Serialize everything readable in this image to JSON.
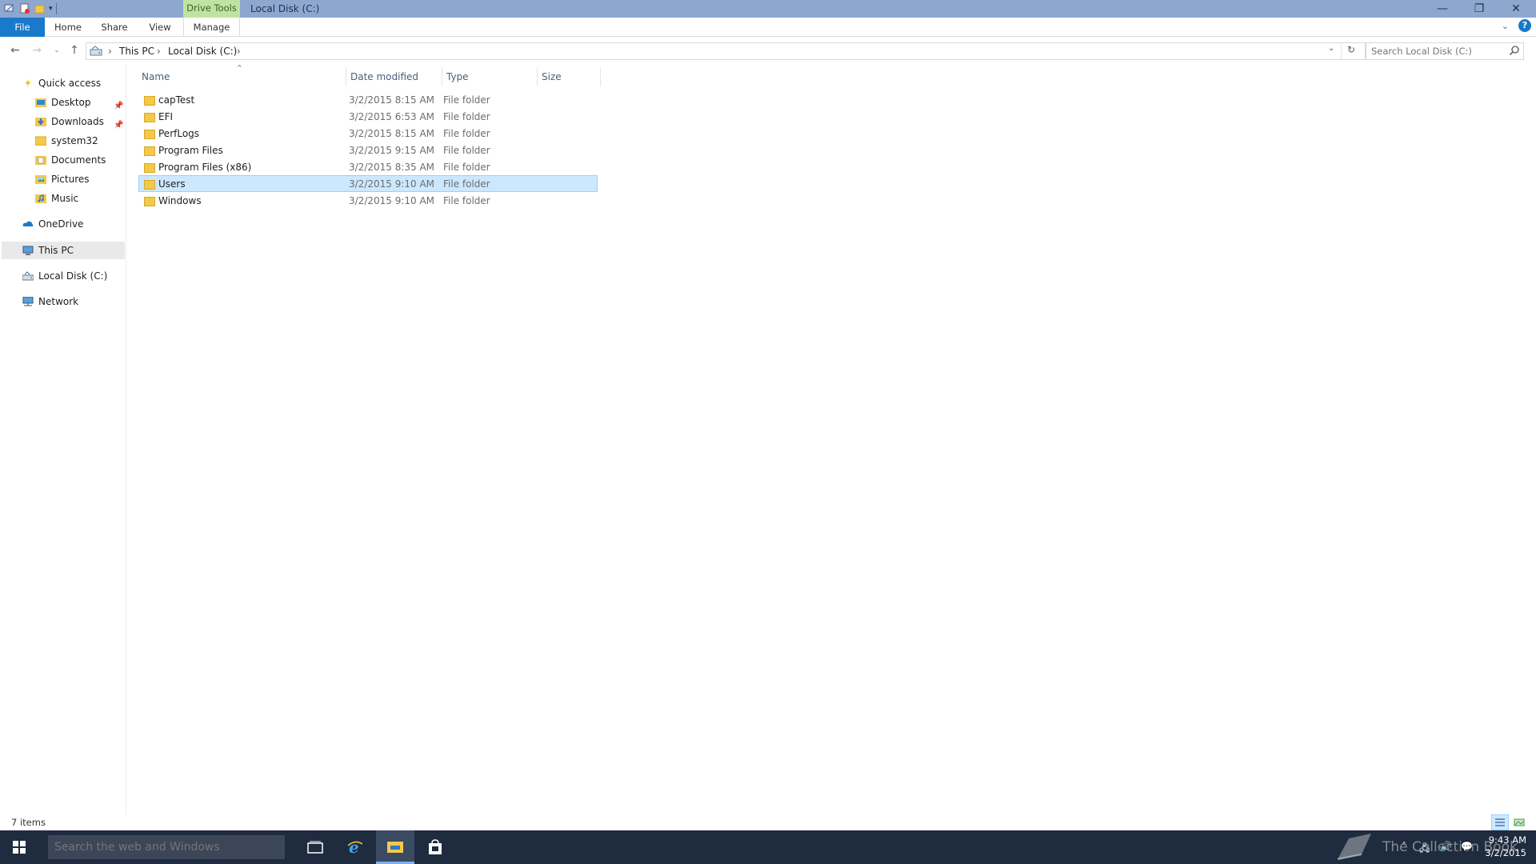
{
  "window": {
    "context_tab": "Drive Tools",
    "title": "Local Disk (C:)"
  },
  "ribbon": {
    "tabs": [
      "File",
      "Home",
      "Share",
      "View",
      "Manage"
    ]
  },
  "address": {
    "crumbs": [
      "This PC",
      "Local Disk (C:)"
    ],
    "search_placeholder": "Search Local Disk (C:)"
  },
  "nav": {
    "quick_access": "Quick access",
    "quick_items": [
      {
        "label": "Desktop",
        "icon": "desktop-folder-icon",
        "pinned": true
      },
      {
        "label": "Downloads",
        "icon": "downloads-folder-icon",
        "pinned": true
      },
      {
        "label": "system32",
        "icon": "folder-icon",
        "pinned": false
      },
      {
        "label": "Documents",
        "icon": "documents-folder-icon",
        "pinned": false
      },
      {
        "label": "Pictures",
        "icon": "pictures-folder-icon",
        "pinned": false
      },
      {
        "label": "Music",
        "icon": "music-folder-icon",
        "pinned": false
      }
    ],
    "onedrive": "OneDrive",
    "this_pc": "This PC",
    "local_disk": "Local Disk (C:)",
    "network": "Network"
  },
  "columns": {
    "name": "Name",
    "date": "Date modified",
    "type": "Type",
    "size": "Size"
  },
  "files": [
    {
      "name": "capTest",
      "date": "3/2/2015 8:15 AM",
      "type": "File folder",
      "selected": false
    },
    {
      "name": "EFI",
      "date": "3/2/2015 6:53 AM",
      "type": "File folder",
      "selected": false
    },
    {
      "name": "PerfLogs",
      "date": "3/2/2015 8:15 AM",
      "type": "File folder",
      "selected": false
    },
    {
      "name": "Program Files",
      "date": "3/2/2015 9:15 AM",
      "type": "File folder",
      "selected": false
    },
    {
      "name": "Program Files (x86)",
      "date": "3/2/2015 8:35 AM",
      "type": "File folder",
      "selected": false
    },
    {
      "name": "Users",
      "date": "3/2/2015 9:10 AM",
      "type": "File folder",
      "selected": true
    },
    {
      "name": "Windows",
      "date": "3/2/2015 9:10 AM",
      "type": "File folder",
      "selected": false
    }
  ],
  "status": {
    "item_count": "7 items"
  },
  "taskbar": {
    "search_placeholder": "Search the web and Windows",
    "watermark": "The Collection Book",
    "time": "9:43 AM",
    "date": "3/2/2015"
  },
  "colors": {
    "titlebar": "#8ea7cf",
    "accent": "#1979ca",
    "selection": "#cce8ff",
    "folder": "#f3c84b",
    "taskbar": "#1f2b3e"
  }
}
